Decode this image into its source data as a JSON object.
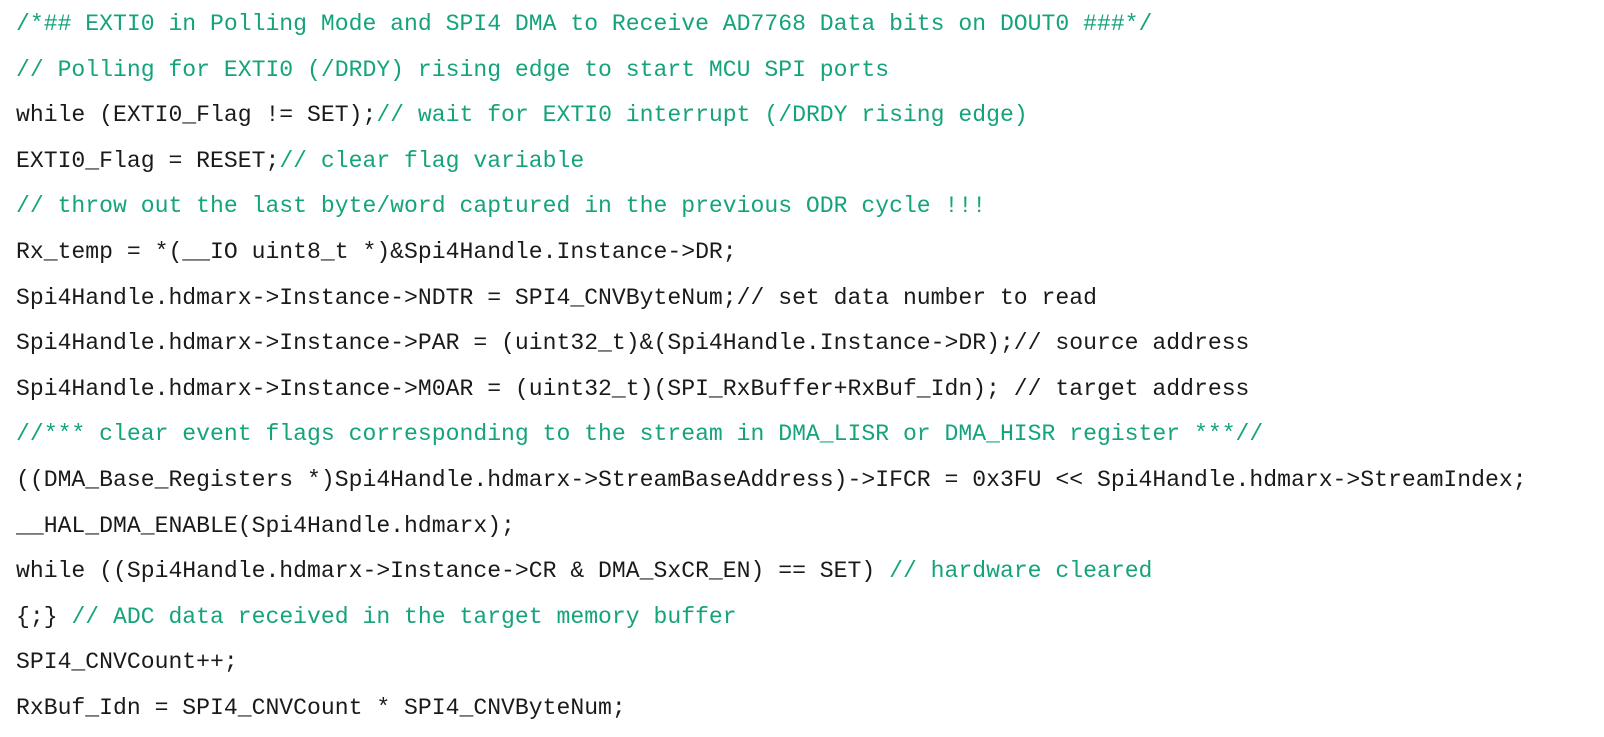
{
  "colors": {
    "code": "#1a1a1a",
    "comment": "#15a37c",
    "background": "#ffffff"
  },
  "lines": [
    {
      "segments": [
        {
          "type": "comment",
          "text": "/*## EXTI0 in Polling Mode and SPI4 DMA to Receive AD7768 Data bits on DOUT0 ###*/"
        }
      ]
    },
    {
      "segments": [
        {
          "type": "comment",
          "text": "// Polling for EXTI0 (/DRDY) rising edge to start MCU SPI ports"
        }
      ]
    },
    {
      "segments": [
        {
          "type": "code",
          "text": "while (EXTI0_Flag != SET);"
        },
        {
          "type": "comment",
          "text": "// wait for EXTI0 interrupt (/DRDY rising edge)"
        }
      ]
    },
    {
      "segments": [
        {
          "type": "code",
          "text": "EXTI0_Flag = RESET;"
        },
        {
          "type": "comment",
          "text": "// clear flag variable"
        }
      ]
    },
    {
      "segments": [
        {
          "type": "comment",
          "text": "// throw out the last byte/word captured in the previous ODR cycle !!!"
        }
      ]
    },
    {
      "segments": [
        {
          "type": "code",
          "text": "Rx_temp = *(__IO uint8_t *)&Spi4Handle.Instance->DR;"
        }
      ]
    },
    {
      "segments": [
        {
          "type": "code",
          "text": "Spi4Handle.hdmarx->Instance->NDTR = SPI4_CNVByteNum;// set data number to read"
        }
      ]
    },
    {
      "segments": [
        {
          "type": "code",
          "text": "Spi4Handle.hdmarx->Instance->PAR = (uint32_t)&(Spi4Handle.Instance->DR);// source address"
        }
      ]
    },
    {
      "segments": [
        {
          "type": "code",
          "text": "Spi4Handle.hdmarx->Instance->M0AR = (uint32_t)(SPI_RxBuffer+RxBuf_Idn); // target address"
        }
      ]
    },
    {
      "segments": [
        {
          "type": "comment",
          "text": "//*** clear event flags corresponding to the stream in DMA_LISR or DMA_HISR register ***//"
        }
      ]
    },
    {
      "segments": [
        {
          "type": "code",
          "text": "((DMA_Base_Registers *)Spi4Handle.hdmarx->StreamBaseAddress)->IFCR = 0x3FU << Spi4Handle.hdmarx->StreamIndex;"
        }
      ]
    },
    {
      "segments": [
        {
          "type": "code",
          "text": "__HAL_DMA_ENABLE(Spi4Handle.hdmarx);"
        }
      ]
    },
    {
      "segments": [
        {
          "type": "code",
          "text": "while ((Spi4Handle.hdmarx->Instance->CR & DMA_SxCR_EN) == SET) "
        },
        {
          "type": "comment",
          "text": "// hardware cleared"
        }
      ]
    },
    {
      "segments": [
        {
          "type": "code",
          "text": "{;} "
        },
        {
          "type": "comment",
          "text": "// ADC data received in the target memory buffer"
        }
      ]
    },
    {
      "segments": [
        {
          "type": "code",
          "text": "SPI4_CNVCount++;"
        }
      ]
    },
    {
      "segments": [
        {
          "type": "code",
          "text": "RxBuf_Idn = SPI4_CNVCount * SPI4_CNVByteNum;"
        }
      ]
    }
  ]
}
